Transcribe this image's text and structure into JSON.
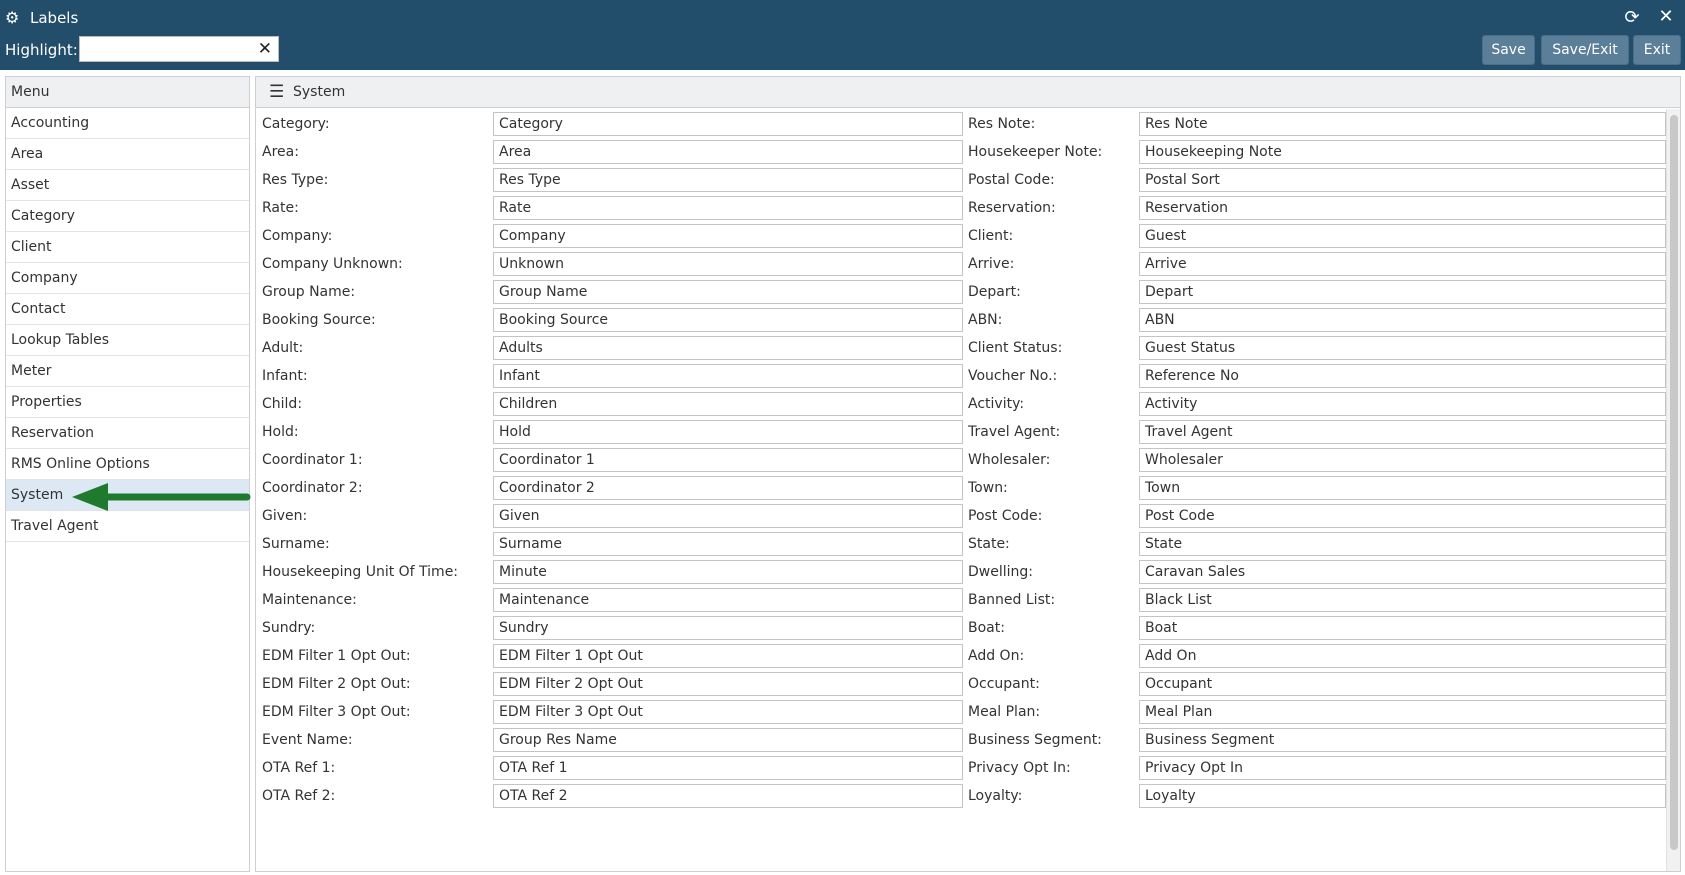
{
  "window": {
    "title": "Labels"
  },
  "highlight": {
    "label": "Highlight:",
    "value": ""
  },
  "toolbar": {
    "save": "Save",
    "save_exit": "Save/Exit",
    "exit": "Exit"
  },
  "menu": {
    "header": "Menu",
    "items": [
      "Accounting",
      "Area",
      "Asset",
      "Category",
      "Client",
      "Company",
      "Contact",
      "Lookup Tables",
      "Meter",
      "Properties",
      "Reservation",
      "RMS Online Options",
      "System",
      "Travel Agent"
    ],
    "active": "System"
  },
  "main": {
    "title": "System",
    "left_fields": [
      {
        "label": "Category:",
        "value": "Category"
      },
      {
        "label": "Area:",
        "value": "Area"
      },
      {
        "label": "Res Type:",
        "value": "Res Type"
      },
      {
        "label": "Rate:",
        "value": "Rate"
      },
      {
        "label": "Company:",
        "value": "Company"
      },
      {
        "label": "Company Unknown:",
        "value": "Unknown"
      },
      {
        "label": "Group Name:",
        "value": "Group Name"
      },
      {
        "label": "Booking Source:",
        "value": "Booking Source"
      },
      {
        "label": "Adult:",
        "value": "Adults"
      },
      {
        "label": "Infant:",
        "value": "Infant"
      },
      {
        "label": "Child:",
        "value": "Children"
      },
      {
        "label": "Hold:",
        "value": "Hold"
      },
      {
        "label": "Coordinator 1:",
        "value": "Coordinator 1"
      },
      {
        "label": "Coordinator 2:",
        "value": "Coordinator 2"
      },
      {
        "label": "Given:",
        "value": "Given"
      },
      {
        "label": "Surname:",
        "value": "Surname"
      },
      {
        "label": "Housekeeping Unit Of Time:",
        "value": "Minute"
      },
      {
        "label": "Maintenance:",
        "value": "Maintenance"
      },
      {
        "label": "Sundry:",
        "value": "Sundry"
      },
      {
        "label": "EDM Filter 1 Opt Out:",
        "value": "EDM Filter 1 Opt Out"
      },
      {
        "label": "EDM Filter 2 Opt Out:",
        "value": "EDM Filter 2 Opt Out"
      },
      {
        "label": "EDM Filter 3 Opt Out:",
        "value": "EDM Filter 3 Opt Out"
      },
      {
        "label": "Event Name:",
        "value": "Group Res Name"
      },
      {
        "label": "OTA Ref 1:",
        "value": "OTA Ref 1"
      },
      {
        "label": "OTA Ref 2:",
        "value": "OTA Ref 2"
      }
    ],
    "right_fields": [
      {
        "label": "Res Note:",
        "value": "Res Note"
      },
      {
        "label": "Housekeeper Note:",
        "value": "Housekeeping Note"
      },
      {
        "label": "Postal Code:",
        "value": "Postal Sort"
      },
      {
        "label": "Reservation:",
        "value": "Reservation"
      },
      {
        "label": "Client:",
        "value": "Guest"
      },
      {
        "label": "Arrive:",
        "value": "Arrive"
      },
      {
        "label": "Depart:",
        "value": "Depart"
      },
      {
        "label": "ABN:",
        "value": "ABN"
      },
      {
        "label": "Client Status:",
        "value": "Guest Status"
      },
      {
        "label": "Voucher No.:",
        "value": "Reference No"
      },
      {
        "label": "Activity:",
        "value": "Activity"
      },
      {
        "label": "Travel Agent:",
        "value": "Travel Agent"
      },
      {
        "label": "Wholesaler:",
        "value": "Wholesaler"
      },
      {
        "label": "Town:",
        "value": "Town"
      },
      {
        "label": "Post Code:",
        "value": "Post Code"
      },
      {
        "label": "State:",
        "value": "State"
      },
      {
        "label": "Dwelling:",
        "value": "Caravan Sales"
      },
      {
        "label": "Banned List:",
        "value": "Black List"
      },
      {
        "label": "Boat:",
        "value": "Boat"
      },
      {
        "label": "Add On:",
        "value": "Add On"
      },
      {
        "label": "Occupant:",
        "value": "Occupant"
      },
      {
        "label": "Meal Plan:",
        "value": "Meal Plan"
      },
      {
        "label": "Business Segment:",
        "value": "Business Segment"
      },
      {
        "label": "Privacy Opt In:",
        "value": "Privacy Opt In"
      },
      {
        "label": "Loyalty:",
        "value": "Loyalty"
      }
    ]
  },
  "colors": {
    "titlebar": "#234e6b",
    "button": "#5b7f99",
    "active_item": "#dce9f5",
    "arrow": "#1f7a2e"
  }
}
